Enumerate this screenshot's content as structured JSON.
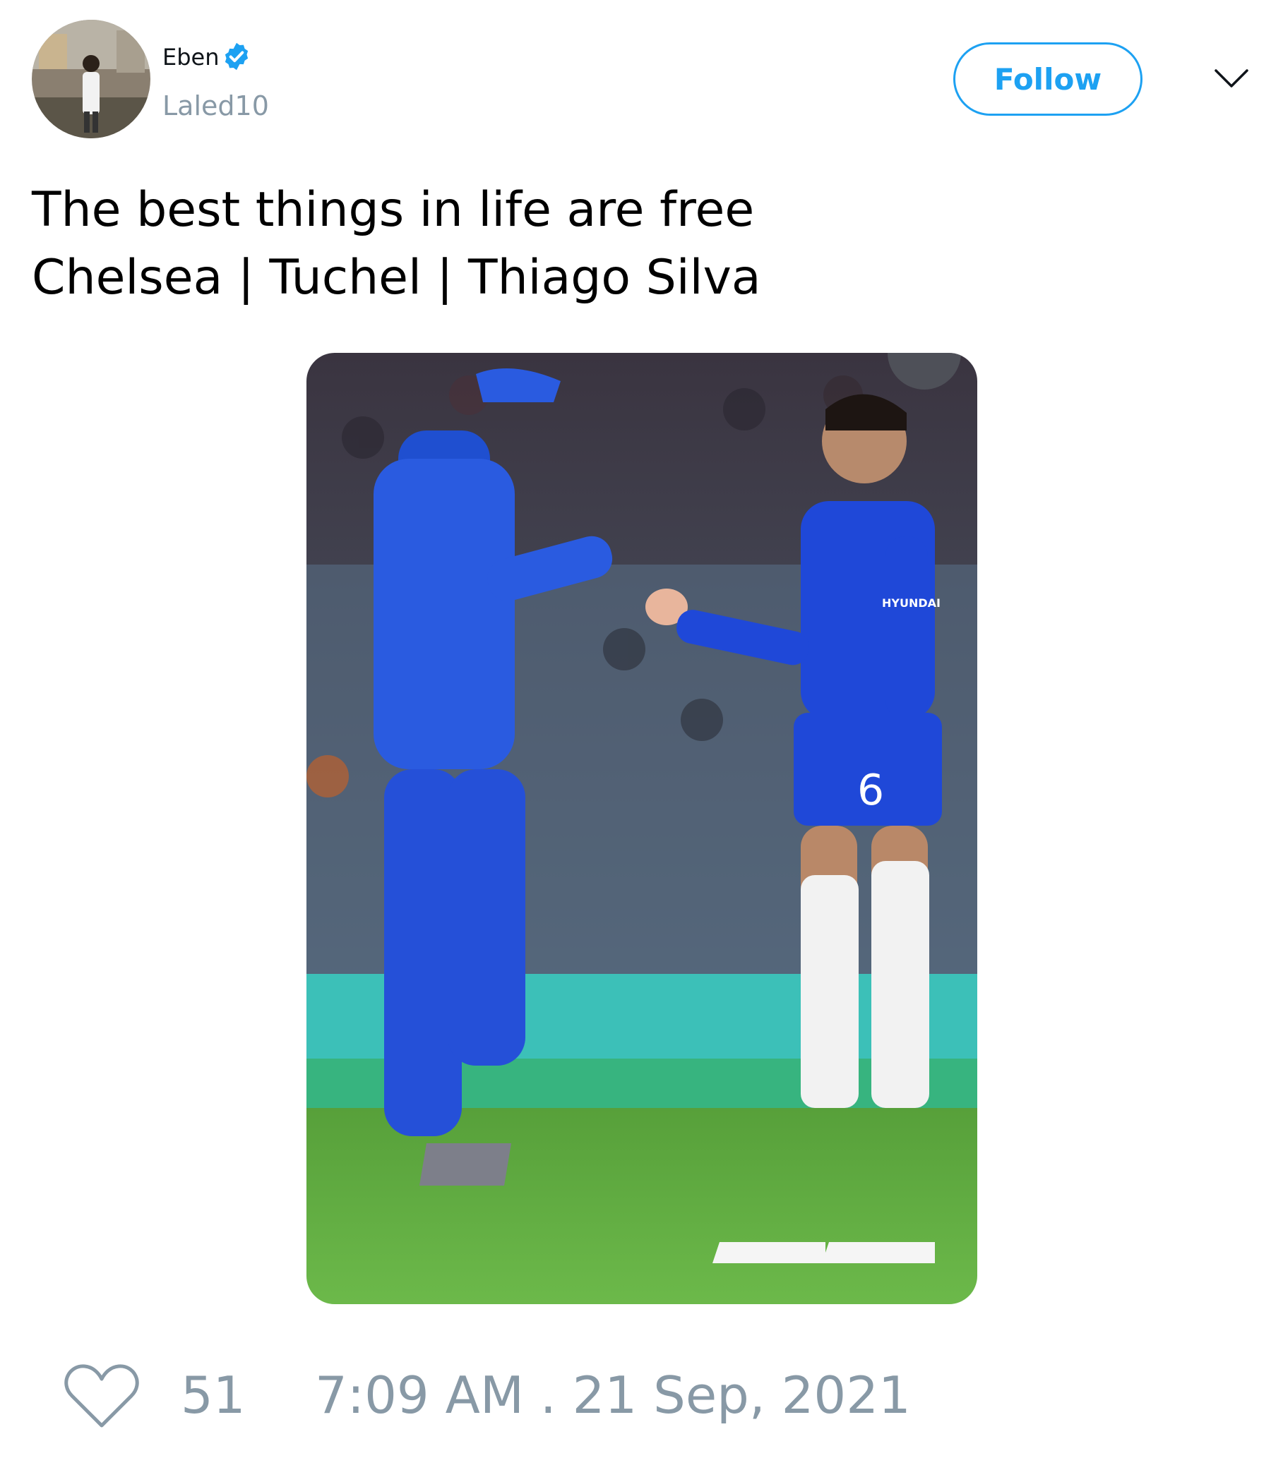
{
  "author": {
    "display_name": "Eben",
    "handle": "Laled10",
    "verified": true,
    "avatar_icon": "user-avatar-photo"
  },
  "follow_label": "Follow",
  "menu_icon": "chevron-down-icon",
  "tweet": {
    "line1": "The best things in life are free",
    "line2": "Chelsea | Tuchel | Thiago Silva"
  },
  "media": {
    "description_icon": "photo",
    "jersey_sponsor": "HYUNDAI",
    "jersey_number": "6"
  },
  "footer": {
    "like_icon": "heart-icon",
    "like_count": "51",
    "timestamp": "7:09 AM . 21 Sep, 2021"
  },
  "colors": {
    "accent": "#1da1f2",
    "muted": "#8899a6",
    "text": "#000000"
  }
}
